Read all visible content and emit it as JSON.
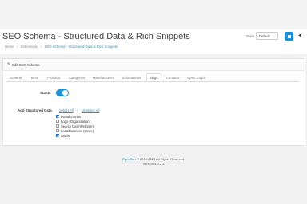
{
  "header": {
    "title": "SEO Schema - Structured Data & Rich Snippets",
    "breadcrumb": [
      "Home",
      "Extensions",
      "SEO Schema - Structured Data & Rich Snippets"
    ],
    "store_label": "Store",
    "store_value": "Default"
  },
  "panel": {
    "heading": "Edit SEO Schema",
    "tabs": [
      {
        "label": "General"
      },
      {
        "label": "Home"
      },
      {
        "label": "Products"
      },
      {
        "label": "Categories"
      },
      {
        "label": "Manufacturers"
      },
      {
        "label": "Informations"
      },
      {
        "label": "Blogs"
      },
      {
        "label": "Contacts"
      },
      {
        "label": "Open Graph"
      }
    ],
    "active_tab": "Blogs",
    "status_label": "Status",
    "status_on": true,
    "structured_label": "Add Structured Data",
    "select_all": "Select All",
    "unselect_all": "Unselect All",
    "options": [
      {
        "label": "Breadcrumbs",
        "checked": true
      },
      {
        "label": "Logo (Organization)",
        "checked": false
      },
      {
        "label": "Search box (WebSite)",
        "checked": false
      },
      {
        "label": "LocalBusiness (Store)",
        "checked": false
      },
      {
        "label": "Article",
        "checked": true
      }
    ]
  },
  "footer": {
    "brand": "OpenCart",
    "copyright": "© 2009-2023 All Rights Reserved.",
    "version": "Version 4.0.2.3"
  },
  "colors": {
    "accent": "#1e91cf"
  }
}
